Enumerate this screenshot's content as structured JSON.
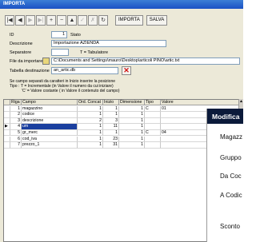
{
  "window": {
    "title": "IMPORTA"
  },
  "toolbar": {
    "nav_buttons": [
      "|◀",
      "◀",
      "▶",
      "▶|",
      "+",
      "−",
      "▲",
      "✓",
      "✗",
      "↻"
    ],
    "import_label": "IMPORTA",
    "save_label": "SALVA"
  },
  "form": {
    "id_label": "ID",
    "id_value": "1",
    "stato_label": "Stato",
    "descrizione_label": "Descrizione",
    "descrizione_value": "Importazione AZIENDA",
    "separatore_label": "Separatore",
    "separatore_value": "",
    "separatore_hint": "T = Tabulatore",
    "file_label": "File da importare",
    "file_value": "C:\\Documents and Settings\\mauro\\Desktop\\articoli PINO\\artic.txt",
    "tabella_label": "Tabella destinazione",
    "tabella_value": "an_artic.db"
  },
  "notes": [
    "Se campo separati da caratteri in Inizio inserire la posizione",
    "Tipo :  'I' = Incrementale  (in Valore il numero da cui iniziare)",
    "'C' = Valore costante ( in Valore il contenuto del campo)"
  ],
  "grid": {
    "columns": [
      "Riga",
      "Campo",
      "Ord. Concat",
      "Inizio",
      "Dimensione",
      "Tipo",
      "Valore"
    ],
    "rows": [
      [
        "1",
        "magazzino",
        "1",
        "1",
        "1",
        "C",
        "01"
      ],
      [
        "2",
        "codice",
        "1",
        "1",
        "1",
        "",
        ""
      ],
      [
        "3",
        "descrizione",
        "2",
        "3",
        "1",
        "",
        ""
      ],
      [
        "4",
        "um",
        "1",
        "11",
        "1",
        "",
        ""
      ],
      [
        "5",
        "gr_merc",
        "1",
        "1",
        "1",
        "C",
        "04"
      ],
      [
        "6",
        "cod_iva",
        "1",
        "23",
        "1",
        "",
        ""
      ],
      [
        "7",
        "prezzo_1",
        "1",
        "31",
        "1",
        "",
        ""
      ]
    ],
    "selected_row_index": 3
  },
  "overlay_window": {
    "title": "Modifica",
    "items": [
      "Magazz",
      "Gruppo",
      "Da Coc",
      "A Codic",
      "Sconto"
    ]
  }
}
